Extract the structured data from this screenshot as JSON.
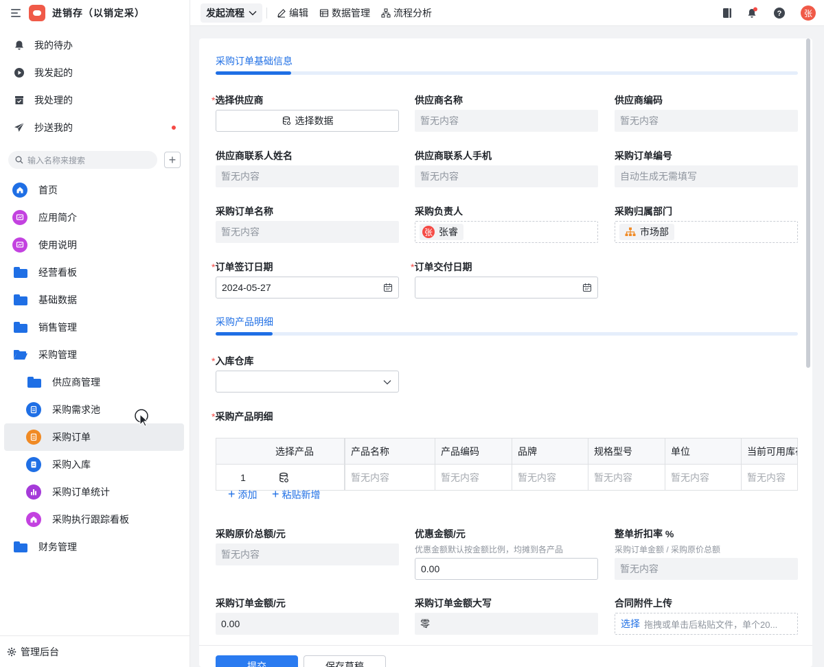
{
  "app": {
    "title": "进销存（以销定采）"
  },
  "sidebar": {
    "quick": [
      {
        "label": "我的待办",
        "icon": "bell-icon"
      },
      {
        "label": "我发起的",
        "icon": "play-circle-icon"
      },
      {
        "label": "我处理的",
        "icon": "inbox-check-icon"
      },
      {
        "label": "抄送我的",
        "icon": "send-icon"
      }
    ],
    "search_placeholder": "输入名称来搜索",
    "add_label": "+",
    "nav": [
      {
        "label": "首页",
        "icon": "home-icon",
        "color": "#1f6fe5"
      },
      {
        "label": "应用简介",
        "icon": "presentation-icon",
        "color": "#c342e0"
      },
      {
        "label": "使用说明",
        "icon": "presentation-icon",
        "color": "#c342e0"
      },
      {
        "label": "经营看板",
        "icon": "folder-icon"
      },
      {
        "label": "基础数据",
        "icon": "folder-icon"
      },
      {
        "label": "销售管理",
        "icon": "folder-icon"
      },
      {
        "label": "采购管理",
        "icon": "folder-open-icon"
      },
      {
        "label": "供应商管理",
        "icon": "folder-icon"
      },
      {
        "label": "采购需求池",
        "icon": "form-icon",
        "color": "#1f6fe5"
      },
      {
        "label": "采购订单",
        "icon": "form-icon",
        "color": "#f08a24"
      },
      {
        "label": "采购入库",
        "icon": "doc-icon",
        "color": "#1f6fe5"
      },
      {
        "label": "采购订单统计",
        "icon": "bar-chart-icon",
        "color": "#a53bd9"
      },
      {
        "label": "采购执行跟踪看板",
        "icon": "home-icon",
        "color": "#c342e0"
      },
      {
        "label": "财务管理",
        "icon": "folder-icon"
      }
    ],
    "footer_label": "管理后台"
  },
  "topbar": {
    "start_flow": "发起流程",
    "edit": "编辑",
    "data_mgmt": "数据管理",
    "flow_analysis": "流程分析",
    "user_avatar": "张"
  },
  "form": {
    "section1_title": "采购订单基础信息",
    "section2_title": "采购产品明细",
    "placeholder_empty": "暂无内容",
    "fields": {
      "supplier_select": {
        "label": "选择供应商",
        "button": "选择数据"
      },
      "supplier_name": {
        "label": "供应商名称"
      },
      "supplier_code": {
        "label": "供应商编码"
      },
      "contact_name": {
        "label": "供应商联系人姓名"
      },
      "contact_phone": {
        "label": "供应商联系人手机"
      },
      "order_no": {
        "label": "采购订单编号",
        "placeholder": "自动生成无需填写"
      },
      "order_name": {
        "label": "采购订单名称"
      },
      "owner": {
        "label": "采购负责人",
        "value": "张睿",
        "avatar": "张"
      },
      "dept": {
        "label": "采购归属部门",
        "value": "市场部"
      },
      "sign_date": {
        "label": "订单签订日期",
        "value": "2024-05-27"
      },
      "delivery_date": {
        "label": "订单交付日期",
        "value": ""
      },
      "warehouse": {
        "label": "入库仓库"
      },
      "products_label": {
        "label": "采购产品明细"
      },
      "original_total": {
        "label": "采购原价总额/元"
      },
      "discount_amount": {
        "label": "优惠金额/元",
        "hint": "优惠金额默认按金额比例，均摊到各产品",
        "value": "0.00"
      },
      "discount_rate": {
        "label": "整单折扣率 %",
        "hint": "采购订单金额 / 采购原价总额"
      },
      "order_amount": {
        "label": "采购订单金额/元",
        "value": "0.00"
      },
      "amount_upper": {
        "label": "采购订单金额大写",
        "value": "零"
      },
      "attachment": {
        "label": "合同附件上传",
        "select": "选择",
        "hint": "拖拽或单击后粘贴文件，单个20..."
      }
    },
    "table": {
      "headers": [
        "选择产品",
        "产品名称",
        "产品编码",
        "品牌",
        "规格型号",
        "单位",
        "当前可用库存"
      ],
      "rows": [
        {
          "index": "1"
        }
      ]
    },
    "add": "添加",
    "paste_add": "粘贴新增",
    "submit": "提交",
    "save_draft": "保存草稿"
  }
}
